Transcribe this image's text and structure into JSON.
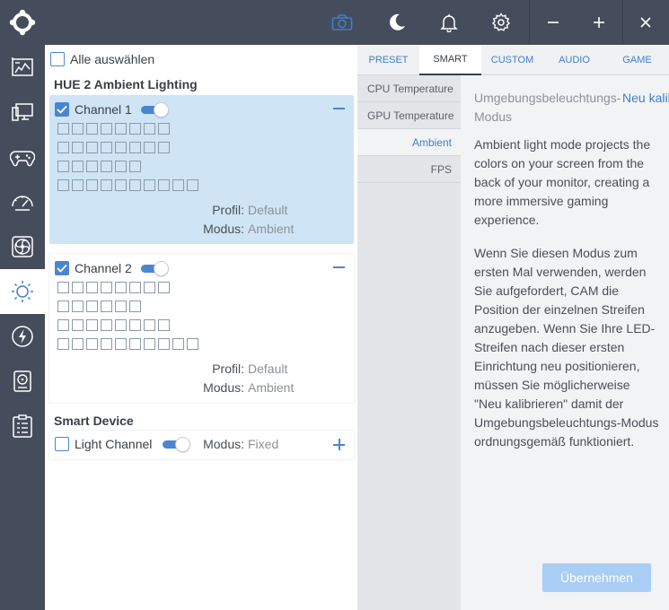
{
  "top_bar": {
    "icons": [
      "logo-icon",
      "camera-icon",
      "moon-icon",
      "bell-icon",
      "gear-icon"
    ],
    "window_controls": {
      "minimize": "−",
      "maximize": "+",
      "close": "×"
    },
    "colors": {
      "background": "#454d5c",
      "active_icon": "#3d7fcb"
    }
  },
  "sidebar": {
    "items": [
      {
        "icon": "dashboard-icon"
      },
      {
        "icon": "monitor-icon"
      },
      {
        "icon": "gamepad-icon"
      },
      {
        "icon": "speedometer-icon"
      },
      {
        "icon": "fan-icon"
      },
      {
        "icon": "lighting-icon",
        "active": true
      },
      {
        "icon": "power-icon"
      },
      {
        "icon": "storage-icon"
      },
      {
        "icon": "checklist-icon"
      }
    ]
  },
  "left_panel": {
    "select_all_label": "Alle auswählen",
    "hue_group_title": "HUE 2 Ambient Lighting",
    "channels": [
      {
        "label": "Channel 1",
        "checked": true,
        "enabled": true,
        "led_rows": [
          8,
          8,
          6,
          10
        ],
        "profile_key": "Profil:",
        "profile_value": "Default",
        "mode_key": "Modus:",
        "mode_value": "Ambient"
      },
      {
        "label": "Channel 2",
        "checked": true,
        "enabled": true,
        "led_rows": [
          8,
          6,
          8,
          10
        ],
        "profile_key": "Profil:",
        "profile_value": "Default",
        "mode_key": "Modus:",
        "mode_value": "Ambient"
      }
    ],
    "smart_device_title": "Smart Device",
    "light_channel": {
      "label": "Light Channel",
      "checked": false,
      "enabled": true,
      "mode_key": "Modus:",
      "mode_value": "Fixed"
    }
  },
  "tabs": [
    {
      "label": "PRESET",
      "active": false
    },
    {
      "label": "SMART",
      "active": true
    },
    {
      "label": "CUSTOM",
      "active": false
    },
    {
      "label": "AUDIO",
      "active": false
    },
    {
      "label": "GAME",
      "active": false
    }
  ],
  "smart_modes": [
    {
      "label": "CPU Temperature",
      "active": false
    },
    {
      "label": "GPU Temperature",
      "active": false
    },
    {
      "label": "Ambient",
      "active": true
    },
    {
      "label": "FPS",
      "active": false
    }
  ],
  "detail": {
    "title": "Umgebungsbeleuchtungs-Modus",
    "recalibrate_link": "Neu kalibrieren",
    "description_en": "Ambient light mode projects the colors on your screen from the back of your monitor, creating a more immersive gaming experience.",
    "description_de": "Wenn Sie diesen Modus zum ersten Mal verwenden, werden Sie aufgefordert, CAM die Position der einzelnen Streifen anzugeben. Wenn Sie Ihre LED-Streifen nach dieser ersten Einrichtung neu positionieren, müssen Sie möglicherweise \"Neu kalibrieren\" damit der Umgebungsbeleuchtungs-Modus ordnungsgemäß funktioniert.",
    "apply_button": "Übernehmen"
  },
  "colors": {
    "accent": "#3d7fcb",
    "selected_card": "#cfe4f5",
    "apply_button_disabled": "#a9cdf4",
    "led_outline": "#8c9aa8"
  }
}
